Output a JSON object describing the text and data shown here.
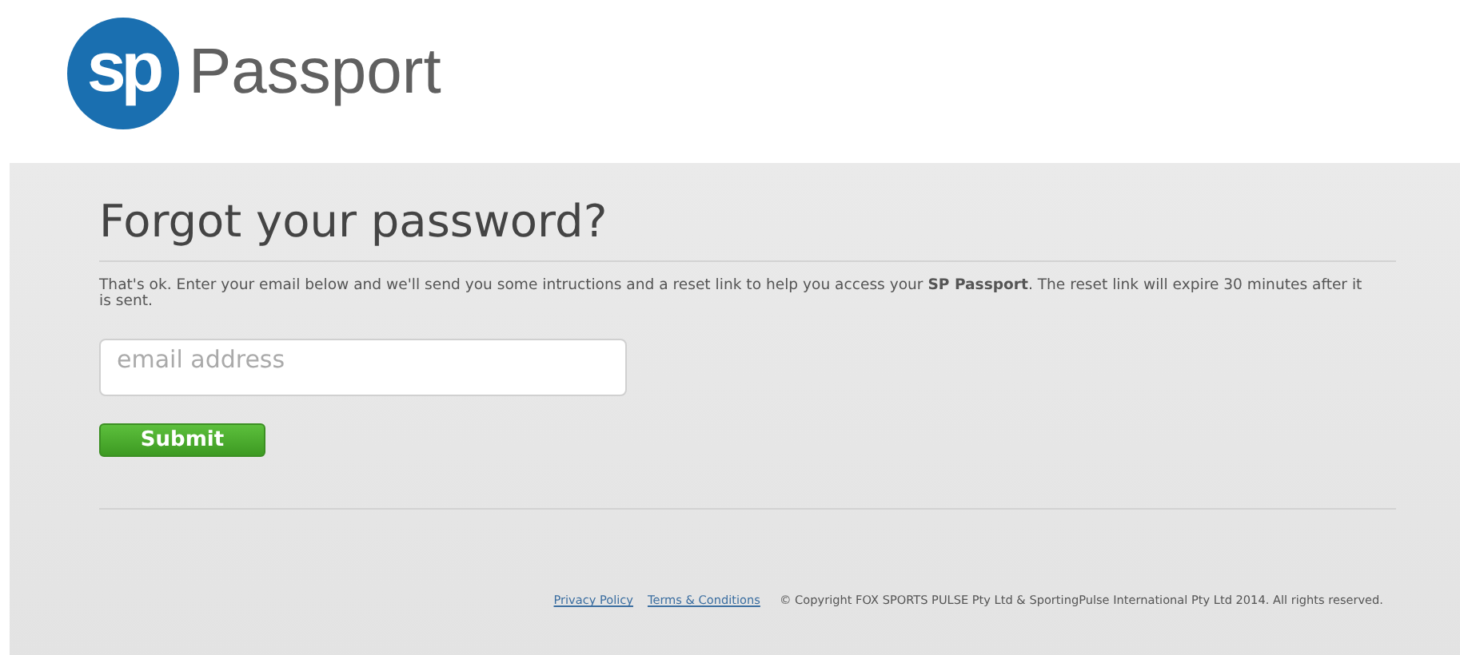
{
  "logo": {
    "mark": "sp",
    "name": "Passport"
  },
  "heading": "Forgot your password?",
  "intro": "That's ok. Enter your email below and we'll send you some intructions and a reset link to help you access your **SP Passport**. The reset link will expire 30 minutes after it is sent.",
  "email_field": {
    "placeholder": "email address"
  },
  "submit_button": "Submit",
  "footer": {
    "links": [
      "Privacy Policy",
      "Terms & Conditions"
    ],
    "copyright": "© Copyright FOX SPORTS PULSE Pty Ltd & SportingPulse International Pty Ltd  2014.  All rights reserved."
  }
}
